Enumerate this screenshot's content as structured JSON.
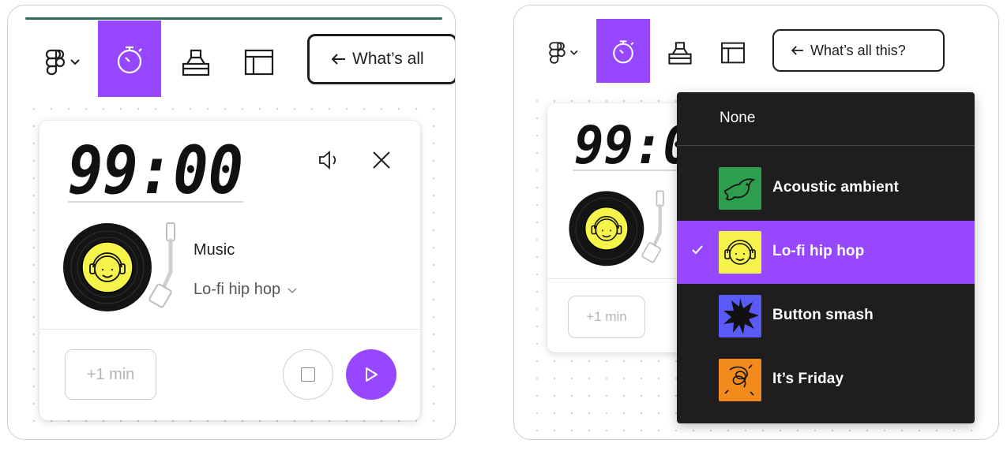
{
  "left_panel": {
    "toolbar": {
      "figma_menu": "figma-logo",
      "timer_tool": "timer-icon",
      "voting_tool": "ballot-box-icon",
      "layout_tool": "table-layout-icon",
      "whats_label": "What’s all"
    },
    "timer": {
      "time_display": "99:00",
      "music_label": "Music",
      "track_label": "Lo-fi hip hop",
      "add_minute_label": "+1 min"
    }
  },
  "right_panel": {
    "toolbar": {
      "whats_label": "What’s all this?"
    },
    "timer": {
      "time_display": "99:0",
      "add_minute_label": "+1 min"
    },
    "music_menu": {
      "none_label": "None",
      "items": [
        {
          "label": "Acoustic ambient",
          "selected": false,
          "thumb_color": "#2e9e4e"
        },
        {
          "label": "Lo-fi hip hop",
          "selected": true,
          "thumb_color": "#f6f34a"
        },
        {
          "label": "Button smash",
          "selected": false,
          "thumb_color": "#5a5af7"
        },
        {
          "label": "It’s Friday",
          "selected": false,
          "thumb_color": "#f28b1c"
        }
      ]
    }
  },
  "colors": {
    "accent": "#9747ff",
    "menu_bg": "#1e1e1e",
    "text": "#1e1e1e"
  }
}
